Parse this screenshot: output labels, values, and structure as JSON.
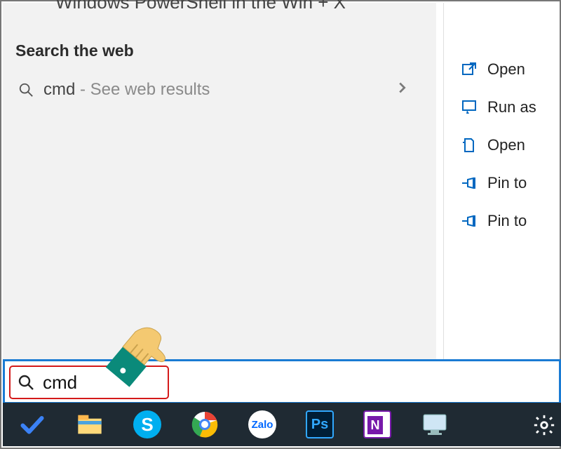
{
  "top_cropped_text": "Windows PowerShell in the Win + X",
  "search_panel": {
    "section_title": "Search the web",
    "web_result": {
      "query": "cmd",
      "suffix": " - See web results"
    }
  },
  "context_menu": {
    "items": [
      {
        "label": "Open",
        "icon": "open-icon"
      },
      {
        "label": "Run as",
        "icon": "run-as-admin-icon"
      },
      {
        "label": "Open ",
        "icon": "open-file-location-icon"
      },
      {
        "label": "Pin to",
        "icon": "pin-to-start-icon"
      },
      {
        "label": "Pin to",
        "icon": "pin-to-taskbar-icon"
      }
    ]
  },
  "search_input": {
    "value": "cmd"
  },
  "taskbar": {
    "items": [
      {
        "name": "todo",
        "label": "Microsoft To Do"
      },
      {
        "name": "file-explorer",
        "label": "File Explorer"
      },
      {
        "name": "skype",
        "label": "Skype"
      },
      {
        "name": "chrome",
        "label": "Google Chrome"
      },
      {
        "name": "zalo",
        "label": "Zalo"
      },
      {
        "name": "photoshop",
        "label": "Adobe Photoshop"
      },
      {
        "name": "onenote",
        "label": "OneNote"
      },
      {
        "name": "remote",
        "label": "Remote Desktop"
      }
    ]
  },
  "colors": {
    "accent": "#0067c0",
    "search_border": "#1a7bd3",
    "highlight_box": "#d41a1a",
    "taskbar_bg": "#1f2a33"
  }
}
